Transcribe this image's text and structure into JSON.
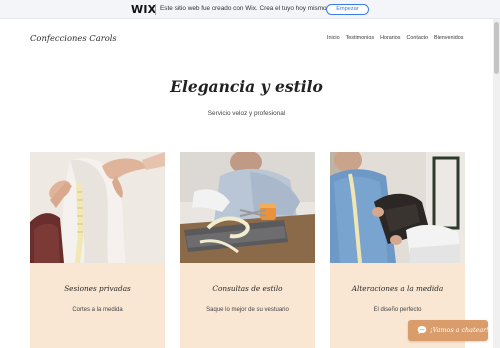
{
  "wix_banner": {
    "logo": "WIX",
    "message": "Este sitio web fue creado con Wix. Crea el tuyo hoy mismo.",
    "button_label": "Empezar"
  },
  "header": {
    "site_title": "Confecciones Carols",
    "nav": [
      "Inicio",
      "Testimonios",
      "Horarios",
      "Contacto",
      "Bienvenidos"
    ]
  },
  "hero": {
    "title": "Elegancia y estilo",
    "subtitle": "Servicio veloz y profesional"
  },
  "services": [
    {
      "title": "Sesiones privadas",
      "description": "Cortes a la medida"
    },
    {
      "title": "Consultas de estilo",
      "description": "Saque lo mejor de su vestuario"
    },
    {
      "title": "Alteraciones a la medida",
      "description": "El diseño perfecto"
    }
  ],
  "chat": {
    "label": "¡Vamos a chatear!",
    "icon": "chat-bubble-icon"
  },
  "colors": {
    "card_background": "#f9e6d3",
    "chat_button": "#d99c6a",
    "wix_accent": "#3b7bf0"
  }
}
